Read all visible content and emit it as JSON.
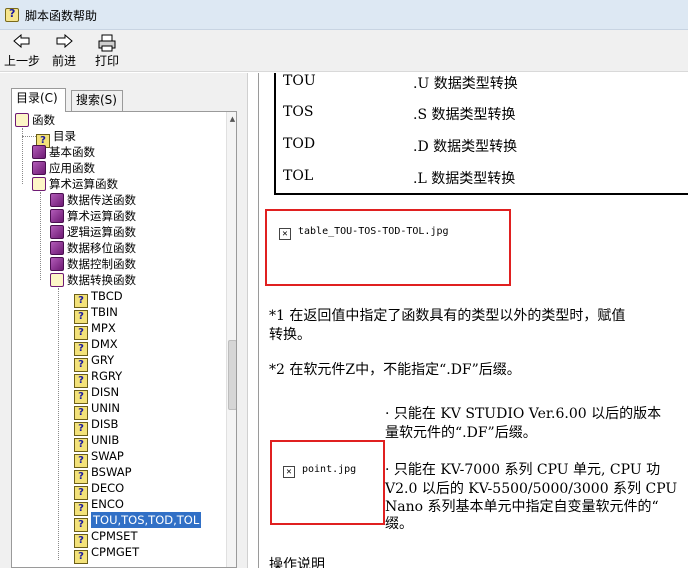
{
  "window": {
    "title": "脚本函数帮助"
  },
  "toolbar": {
    "back": "上一步",
    "forward": "前进",
    "print": "打印"
  },
  "tabs": {
    "contents": "目录(C)",
    "search": "搜索(S)"
  },
  "tree": {
    "root": "函数",
    "contents": "目录",
    "basic": "基本函数",
    "applied": "应用函数",
    "arith": "算术运算函数",
    "sub": [
      "数据传送函数",
      "算术运算函数",
      "逻辑运算函数",
      "数据移位函数",
      "数据控制函数",
      "数据转换函数"
    ],
    "conv": [
      "TBCD",
      "TBIN",
      "MPX",
      "DMX",
      "GRY",
      "RGRY",
      "DISN",
      "UNIN",
      "DISB",
      "UNIB",
      "SWAP",
      "BSWAP",
      "DECO",
      "ENCO",
      "TOU,TOS,TOD,TOL",
      "CPMSET",
      "CPMGET"
    ]
  },
  "content": {
    "rows": [
      {
        "fn": "TOU",
        "desc": ".U 数据类型转换"
      },
      {
        "fn": "TOS",
        "desc": ".S 数据类型转换"
      },
      {
        "fn": "TOD",
        "desc": ".D 数据类型转换"
      },
      {
        "fn": "TOL",
        "desc": ".L 数据类型转换"
      }
    ],
    "image1": "table_TOU-TOS-TOD-TOL.jpg",
    "note1_line1": "*1  在返回值中指定了函数具有的类型以外的类型时，赋值",
    "note1_line2": "转换。",
    "note2": "*2  在软元件Z中，不能指定“.DF”后缀。",
    "bullet1_line1": "· 只能在 KV STUDIO Ver.6.00 以后的版本",
    "bullet1_line2": "量软元件的“.DF”后缀。",
    "image2": "point.jpg",
    "bullet2_line1": "· 只能在 KV-7000 系列 CPU 单元, CPU 功",
    "bullet2_line2": "V2.0 以后的 KV-5500/5000/3000 系列 CPU",
    "bullet2_line3": "Nano 系列基本单元中指定自变量软元件的“",
    "bullet2_line4": "缀。",
    "section": "操作说明"
  },
  "colors": {
    "highlight": "#e02020",
    "selection": "#3170c6"
  }
}
